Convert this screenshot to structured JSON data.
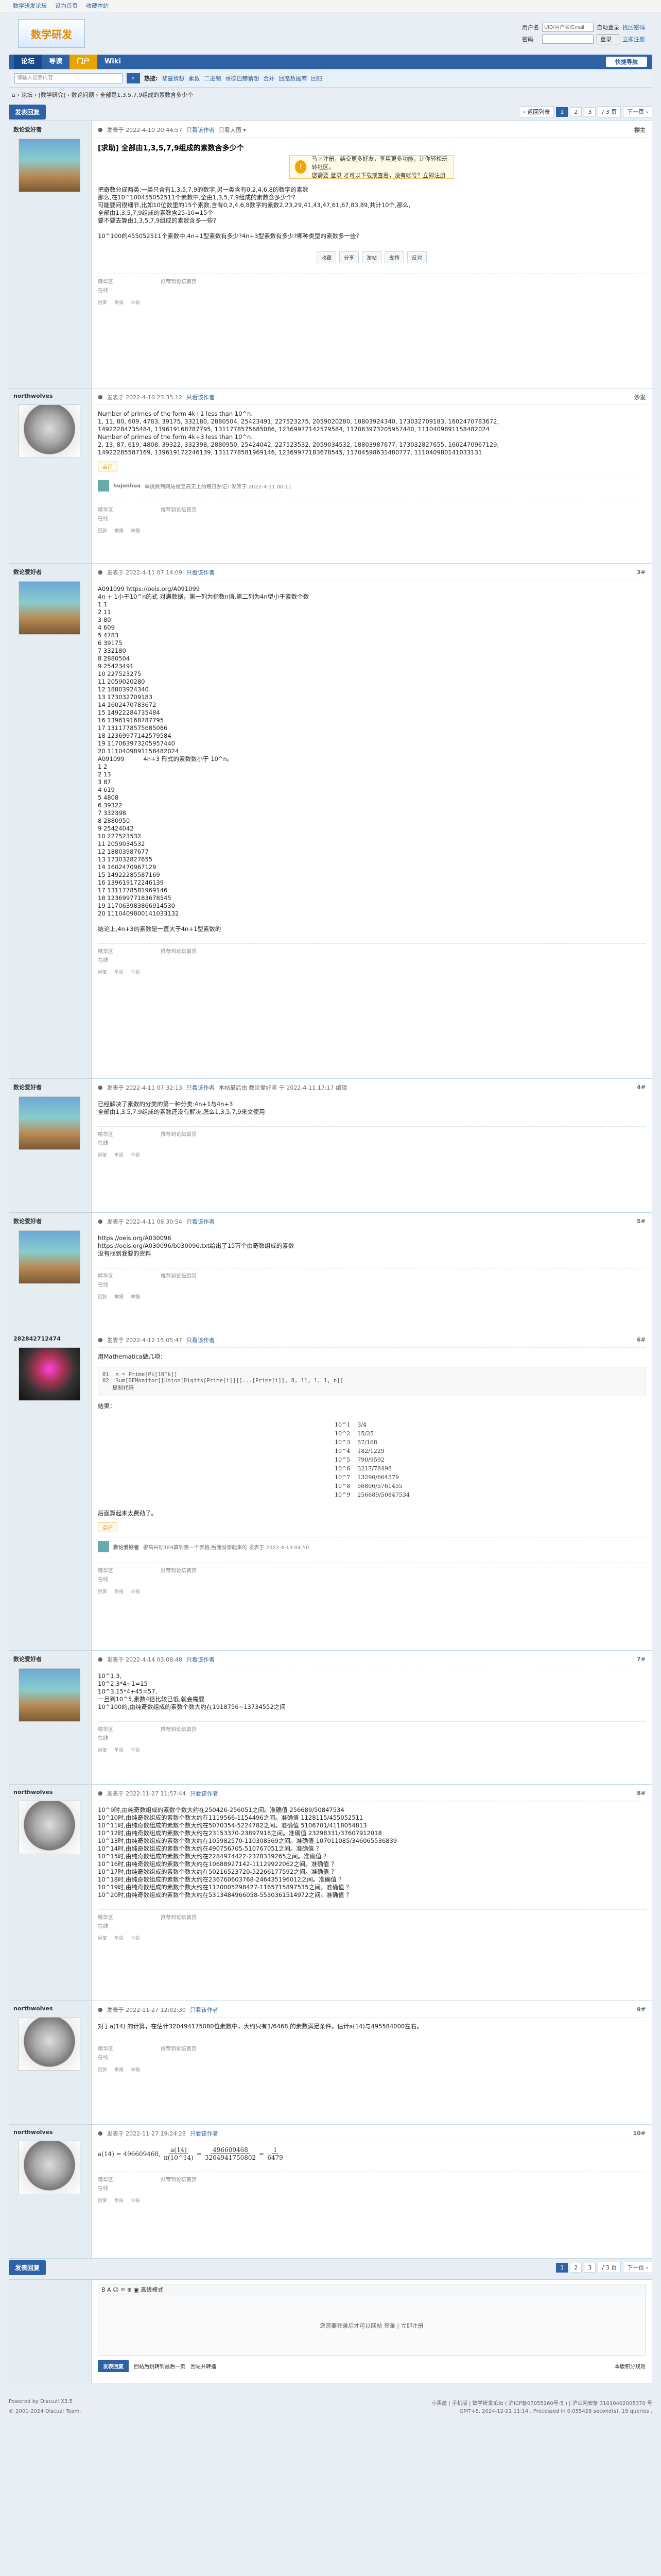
{
  "topbar": {
    "links": [
      "数学研发论坛",
      "设为首页",
      "收藏本站"
    ]
  },
  "header": {
    "logo": "数学研发",
    "login": {
      "user_label": "用户名",
      "user_placeholder": "UID/用户名/Email",
      "remember": "自动登录",
      "forgot": "找回密码",
      "pass_label": "密码",
      "login_btn": "登录",
      "register": "立即注册"
    }
  },
  "nav": {
    "items": [
      "论坛",
      "导读",
      "门户",
      "Wiki"
    ],
    "new_post": "快捷导航"
  },
  "search": {
    "placeholder": "请输入搜索内容",
    "hot_label": "热搜:",
    "hot": [
      "黎曼猜想",
      "素数",
      "二进制",
      "哥德巴赫猜想",
      "合并",
      "回路数据库",
      "回归"
    ]
  },
  "crumb": "⌂  ›  论坛  ›  [数学研究]  ›  数论问题  ›  全部是1,3,5,7,9组成的素数含多少个",
  "pager": {
    "reply": "发表回复",
    "back": "‹ 返回列表",
    "pages": [
      "1",
      "2",
      "3"
    ],
    "of": "/ 3 页",
    "next": "下一页 ›",
    "stats": "查看: 17491 | 回复: 23"
  },
  "topic": {
    "title": "[求助] 全部由1,3,5,7,9组成的素数含多少个",
    "tag": "[复制链接]"
  },
  "posts": [
    {
      "user": "数论爱好者",
      "avatar": "eagle",
      "time": "发表于 2022-4-10 20:44:57",
      "only": "只看该作者",
      "order": "只看大图 ▾",
      "floor": "楼主",
      "extra": "电梯直达",
      "body": "把奇数分成两类:一类只含有1,3,5,7,9的数字,另一类含有0,2,4,6,8的数字的素数\n那么,在10^100455052511个素数中,全由1,3,5,7,9组成的素数含多少个?\n可能要问很细节,比如10位数里的15个素数,含有0,2,4,6,8数字的素数2,23,29,41,43,47,61,67,83,89,共计10个,那么,\n全部由1,3,5,7,9组成的素数含25-10=15个\n要不要去算由1,3,5,7,9组成的素数含多一些?\n\n10^100的455052511个素数中,4n+1型素数有多少?4n+3型素数有多少?哪种类型的素数多一些?",
      "login": "马上注册，结交更多好友，享用更多功能，让你轻松玩转社区。",
      "login2": "您需要 登录 才可以下载或查看，没有帐号？立即注册",
      "actions": [
        "收藏",
        "分享",
        "淘帖",
        "支持",
        "反对"
      ],
      "sig": [
        "精华区",
        "推荐到论坛首页",
        "在线",
        ""
      ]
    },
    {
      "user": "northwolves",
      "avatar": "wolf",
      "time": "发表于 2022-4-10 23:35:12",
      "only": "只看该作者",
      "floor": "沙发",
      "body": "Number of primes of the form 4k+1 less than 10^n.\n1, 11, 80, 609, 4783, 39175, 332180, 2880504, 25423491, 227523275, 2059020280, 18803924340, 173032709183, 1602470783672,\n14922284735484, 139619168787795, 1311778575685086, 12369977142579584, 117063973205957440, 1110409891158482024\nNumber of primes of the form 4k+3 less than 10^n.\n2, 13, 87, 619, 4808, 39322, 332398, 2880950, 25424042, 227523532, 2059034532, 18803987677, 173032827655, 1602470967129,\n14922285587169, 139619172246139, 1311778581969146, 12369977183678545, 11704598631480777, 111040980141033131",
      "rate": "点评",
      "cmt_user": "hujunhua",
      "cmt": "单挑数列网站是至高无上的每日熟记? 发表于 2022-4-11 00:11",
      "sig": [
        "精华区",
        "推荐到论坛首页",
        "在线",
        ""
      ]
    },
    {
      "user": "数论爱好者",
      "avatar": "eagle",
      "time": "发表于 2022-4-11 07:14:09",
      "only": "只看该作者",
      "floor": "3#",
      "body": "A091099 https://oeis.org/A091099\n4n + 1小于10^n的式 对满数据，第一列为指数n值,第二列为4n型小于素数个数\n1 1\n2 11\n3 80\n4 609\n5 4783\n6 39175\n7 332180\n8 2880504\n9 25423491\n10 227523275\n11 2059020280\n12 18803924340\n13 173032709183\n14 1602470783672\n15 14922284735484\n16 139619168787795\n17 1311778575685086\n18 12369977142579584\n19 117063973205957440\n20 1110409891158482024\nA091099          4n+3 形式的素数数小于 10^n。\n1 2\n2 13\n3 87\n4 619\n5 4808\n6 39322\n7 332398\n8 2880950\n9 25424042\n10 227523532\n11 2059034532\n12 18803987677\n13 173032827655\n14 1602470967129\n15 14922285587169\n16 139619172246139\n17 1311778581969146\n18 12369977183678545\n19 117063983866914530\n20 1110409800141033132\n\n结论上,4n+3的素数是一直大于4n+1型素数的",
      "sig": [
        "精华区",
        "推荐到论坛首页",
        "在线",
        ""
      ]
    },
    {
      "user": "数论爱好者",
      "avatar": "eagle",
      "time": "发表于 2022-4-11 07:32:13",
      "only": "只看该作者",
      "floor": "4#",
      "edit": "本帖最后由 数论爱好者 于 2022-4-11 17:17 编辑",
      "body": "已经解决了素数的分类的第一种分类:4n+1与4n+3\n全部由1,3,5,7,9组成的素数还没有解决,怎么1,3,5,7,9来文使用",
      "sig": [
        "精华区",
        "推荐到论坛首页",
        "在线",
        ""
      ]
    },
    {
      "user": "数论爱好者",
      "avatar": "eagle",
      "time": "发表于 2022-4-11 08:30:54",
      "only": "只看该作者",
      "floor": "5#",
      "body": "https://oeis.org/A030096\nhttps://oeis.org/A030096/b030096.txt给出了15万个由奇数组成的素数\n没有找到我要的资料",
      "sig": [
        "精华区",
        "推荐到论坛首页",
        "在线",
        ""
      ]
    },
    {
      "user": "282842712474",
      "avatar": "flower",
      "time": "发表于 2022-4-12 15:05:47",
      "only": "只看该作者",
      "floor": "6#",
      "body": "用Mathematica做几项：",
      "code": "01  n = Prime[Pi[10^k]]\n02  Sum[DEMonitor[[Union[Digits[Prime[i]]]]...[Prime[i]], 8, 11, 1, 1, n]]\n   复制代码",
      "result_label": "结果：",
      "table": [
        [
          "10^1",
          "3/4"
        ],
        [
          "10^2",
          "15/25"
        ],
        [
          "10^3",
          "57/168"
        ],
        [
          "10^4",
          "182/1229"
        ],
        [
          "10^5",
          "790/9592"
        ],
        [
          "10^6",
          "3217/78498"
        ],
        [
          "10^7",
          "13290/664579"
        ],
        [
          "10^8",
          "56806/5761455"
        ],
        [
          "10^9",
          "256689/50847534"
        ]
      ],
      "after": "后面算起来太费劲了。",
      "rate": "点评",
      "cmt_user": "数论爱好者",
      "cmt": "很高兴你1E9算到第一个表格,后面没想起来的 发表于 2022-4-13 04:50",
      "sig": [
        "精华区",
        "推荐到论坛首页",
        "在线",
        ""
      ]
    },
    {
      "user": "数论爱好者",
      "avatar": "eagle",
      "time": "发表于 2022-4-14 03:08:48",
      "only": "只看该作者",
      "floor": "7#",
      "body": "10^1,3,\n10^2,3*4+1=15\n10^3,15*4+45=57,\n一旦到10^5,素数4倍比较已低,就会需要\n10^100的,由纯奇数组成的素数个数大约在1918756~13734552之间",
      "sig": [
        "精华区",
        "推荐到论坛首页",
        "在线",
        ""
      ]
    },
    {
      "user": "northwolves",
      "avatar": "wolf",
      "time": "发表于 2022-11-27 11:57:44",
      "only": "只看该作者",
      "floor": "8#",
      "body": "10^9时,由纯奇数组成的素数个数大约在250426-256051之间。准确值 256689/50847534\n10^10时,由纯奇数组成的素数个数大约在1119566-1154496之间。准确值 1128115/455052511\n10^11时,由纯奇数组成的素数个数大约在5070354-5224782之间。准确值 5106701/4118054813\n10^12时,由纯奇数组成的素数个数大约在23153370-23897918之间。准确值 23298331/37607912018\n10^13时,由纯奇数组成的素数个数大约在105982570-110308369之间。准确值 107011085/346065536839\n10^14时,由纯奇数组成的素数个数大约在490756705-510767051之间。准确值 ？\n10^15时,由纯奇数组成的素数个数大约在2284974422-2378339265之间。准确值 ？\n10^16时,由纯奇数组成的素数个数大约在10688927142-11129922062之间。准确值 ？\n10^17时,由纯奇数组成的素数个数大约在50216523720-52266177592之间。准确值 ？\n10^18时,由纯奇数组成的素数个数大约在236760603768-246435196012之间。准确值 ？\n10^19时,由纯奇数组成的素数个数大约在1120005298427-1165715897535之间。准确值 ？\n10^20时,由纯奇数组成的素数个数大约在5313484966058-5530361514972之间。准确值 ？",
      "sig": [
        "精华区",
        "推荐到论坛首页",
        "在线",
        ""
      ]
    },
    {
      "user": "northwolves",
      "avatar": "wolf",
      "time": "发表于 2022-11-27 12:02:30",
      "only": "只看该作者",
      "floor": "9#",
      "body": "对于a(14) 的计算，在估计320494175080位素数中，大约只有1/6468 的素数满足条件。估计a(14)与495584000左右。",
      "sig": [
        "精华区",
        "推荐到论坛首页",
        "在线",
        ""
      ]
    },
    {
      "user": "northwolves",
      "avatar": "wolf",
      "time": "发表于 2022-11-27 19:24:28",
      "only": "只看该作者",
      "floor": "10#",
      "formula": {
        "lhs": "a(14) = 496609468,",
        "frac1_num": "a(14)",
        "frac1_den": "π(10^14)",
        "eq": "=",
        "frac2_num": "496609468",
        "frac2_den": "3204941750802",
        "frac3_num": "1",
        "frac3_den": "6479"
      },
      "sig": [
        "精华区",
        "推荐到论坛首页",
        "在线",
        ""
      ]
    }
  ],
  "post_footer": [
    "回复",
    "举报",
    "举报"
  ],
  "editor": {
    "toolbar": "B  A  ☺  ≡  ⊕  ▣  高级模式",
    "placeholder": "您需要登录后才可以回帖 登录 | 立即注册",
    "submit": "发表回复",
    "opt1": "回帖后跳转到最后一页",
    "opt2": "回帖并转播",
    "rules": "本版积分规则"
  },
  "footer": {
    "powered": "Powered by Discuz! X3.5",
    "copy": "© 2001-2024 Discuz! Team.",
    "links": "小黑屋  |  手机版  |  数学研发论坛 ( 沪ICP备07055160号-5 )  |  沪公网安备 31010402005370 号",
    "time": "GMT+8, 2024-12-21 11:14 , Processed in 0.055428 second(s), 19 queries ."
  }
}
